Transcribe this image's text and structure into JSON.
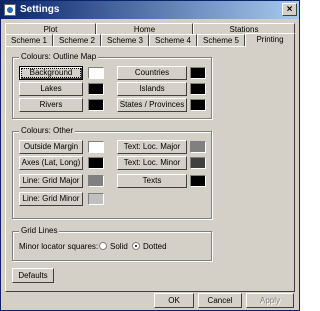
{
  "window": {
    "title": "Settings",
    "close_glyph": "×"
  },
  "tabs": {
    "row_top": [
      "Plot",
      "Home",
      "Stations"
    ],
    "row_bottom": [
      "Scheme 1",
      "Scheme 2",
      "Scheme 3",
      "Scheme 4",
      "Scheme 5",
      "Printing"
    ],
    "active": "Printing"
  },
  "outline": {
    "label": "Colours: Outline Map",
    "items": [
      {
        "label": "Background",
        "color": "#ffffff"
      },
      {
        "label": "Lakes",
        "color": "#000000"
      },
      {
        "label": "Rivers",
        "color": "#000000"
      },
      {
        "label": "Countries",
        "color": "#000000"
      },
      {
        "label": "Islands",
        "color": "#000000"
      },
      {
        "label": "States / Provinces",
        "color": "#000000"
      }
    ]
  },
  "other": {
    "label": "Colours: Other",
    "items": [
      {
        "label": "Outside Margin",
        "color": "#ffffff"
      },
      {
        "label": "Axes (Lat, Long)",
        "color": "#000000"
      },
      {
        "label": "Line: Grid Major",
        "color": "#808080"
      },
      {
        "label": "Line: Grid Minor",
        "color": "#c0c0c0"
      },
      {
        "label": "Text: Loc. Major",
        "color": "#808080"
      },
      {
        "label": "Text: Loc. Minor",
        "color": "#404040"
      },
      {
        "label": "Texts",
        "color": "#000000"
      }
    ]
  },
  "gridlines": {
    "label": "Grid Lines",
    "minor_label": "Minor locator squares:",
    "option_solid": "Solid",
    "option_dotted": "Dotted",
    "selected": "Dotted"
  },
  "buttons": {
    "defaults": "Defaults",
    "ok": "OK",
    "cancel": "Cancel",
    "apply": "Apply"
  }
}
